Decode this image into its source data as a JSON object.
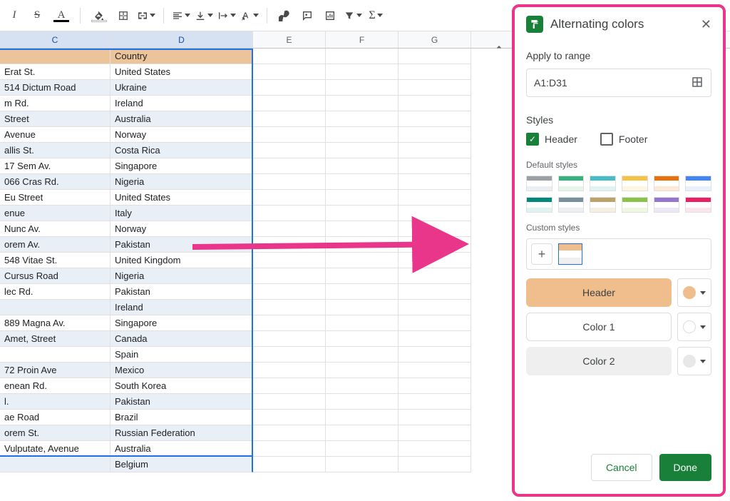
{
  "toolbar": {
    "italic": "I",
    "strike": "S",
    "textcolor": "A",
    "textcolor_underbar": "#000",
    "fillcolor_underbar": "#fff"
  },
  "cols": [
    "C",
    "D",
    "E",
    "F",
    "G"
  ],
  "spreadsheet": {
    "header": {
      "c": "",
      "d": "Country"
    },
    "rows": [
      {
        "c": "Erat St.",
        "d": "United States"
      },
      {
        "c": "514 Dictum Road",
        "d": "Ukraine"
      },
      {
        "c": "m Rd.",
        "d": "Ireland"
      },
      {
        "c": "Street",
        "d": "Australia"
      },
      {
        "c": "Avenue",
        "d": "Norway"
      },
      {
        "c": "allis St.",
        "d": "Costa Rica"
      },
      {
        "c": "17 Sem Av.",
        "d": "Singapore"
      },
      {
        "c": "066 Cras Rd.",
        "d": "Nigeria"
      },
      {
        "c": "Eu Street",
        "d": "United States"
      },
      {
        "c": "enue",
        "d": "Italy"
      },
      {
        "c": "Nunc Av.",
        "d": "Norway"
      },
      {
        "c": "orem Av.",
        "d": "Pakistan"
      },
      {
        "c": "548 Vitae St.",
        "d": "United Kingdom"
      },
      {
        "c": "Cursus Road",
        "d": "Nigeria"
      },
      {
        "c": "lec Rd.",
        "d": "Pakistan"
      },
      {
        "c": "",
        "d": "Ireland"
      },
      {
        "c": "889 Magna Av.",
        "d": "Singapore"
      },
      {
        "c": "Amet, Street",
        "d": "Canada"
      },
      {
        "c": "",
        "d": "Spain"
      },
      {
        "c": "72 Proin Ave",
        "d": "Mexico"
      },
      {
        "c": "enean Rd.",
        "d": "South Korea"
      },
      {
        "c": "l.",
        "d": "Pakistan"
      },
      {
        "c": "ae Road",
        "d": "Brazil"
      },
      {
        "c": "orem St.",
        "d": "Russian Federation"
      },
      {
        "c": "Vulputate, Avenue",
        "d": "Australia"
      },
      {
        "c": "",
        "d": "Belgium"
      }
    ]
  },
  "panel": {
    "title": "Alternating colors",
    "apply_label": "Apply to range",
    "range": "A1:D31",
    "styles_label": "Styles",
    "header_label": "Header",
    "footer_label": "Footer",
    "default_styles_label": "Default styles",
    "default_styles_colors": [
      {
        "top": "#9aa0a6",
        "bot": "#eceff1"
      },
      {
        "top": "#35b27d",
        "bot": "#e6f4ea"
      },
      {
        "top": "#46bdc6",
        "bot": "#e0f2f1"
      },
      {
        "top": "#f5c244",
        "bot": "#fef7e0"
      },
      {
        "top": "#e8710a",
        "bot": "#fce8d4"
      },
      {
        "top": "#4285f4",
        "bot": "#e8f0fe"
      },
      {
        "top": "#00897b",
        "bot": "#e0f2f1"
      },
      {
        "top": "#78909c",
        "bot": "#eceff1"
      },
      {
        "top": "#bda26a",
        "bot": "#f5efe1"
      },
      {
        "top": "#8bc34a",
        "bot": "#edf7e1"
      },
      {
        "top": "#9575cd",
        "bot": "#ede7f6"
      },
      {
        "top": "#e91e63",
        "bot": "#fce4ec"
      }
    ],
    "custom_styles_label": "Custom styles",
    "custom_preview": {
      "top": "#f0be8c",
      "mid": "#ffffff",
      "bot": "#efefef"
    },
    "color_rows": [
      {
        "name": "Header",
        "bg": "#f0be8c",
        "dot": "#f0be8c"
      },
      {
        "name": "Color 1",
        "bg": "#ffffff",
        "dot": "#ffffff"
      },
      {
        "name": "Color 2",
        "bg": "#efefef",
        "dot": "#e8e8e8"
      }
    ],
    "cancel": "Cancel",
    "done": "Done"
  }
}
